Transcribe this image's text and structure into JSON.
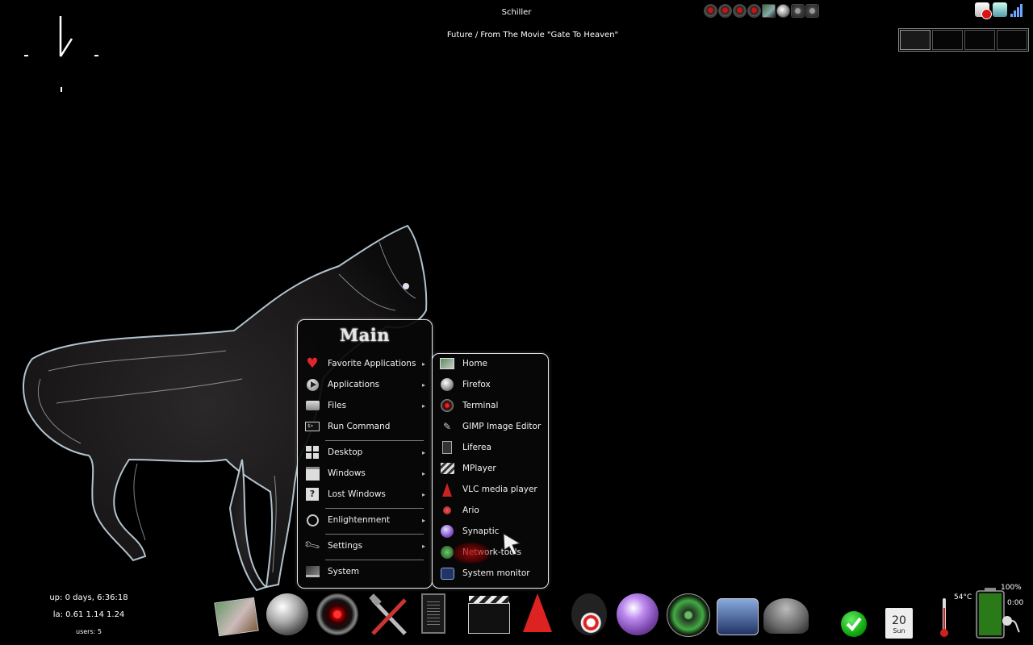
{
  "now_playing": {
    "artist": "Schiller",
    "track": "Future / From The Movie \"Gate To Heaven\""
  },
  "tray": {
    "icons": [
      "hal-icon",
      "hal-icon",
      "hal-icon",
      "hal-icon",
      "home-folder-icon",
      "globe-icon",
      "gnome-face-icon",
      "gnome-face-icon"
    ]
  },
  "notification_area": {
    "icons": [
      "blocked-notification-icon",
      "network-manager-icon",
      "signal-strength-icon"
    ]
  },
  "pager": {
    "desktops": 4,
    "active": 0
  },
  "main_menu": {
    "title": "Main",
    "items": [
      {
        "label": "Favorite Applications",
        "icon": "heart-icon",
        "submenu": true
      },
      {
        "label": "Applications",
        "icon": "play-icon",
        "submenu": true
      },
      {
        "label": "Files",
        "icon": "folder-icon",
        "submenu": true
      },
      {
        "label": "Run Command",
        "icon": "terminal-icon",
        "submenu": false
      },
      {
        "label": "Desktop",
        "icon": "grid-icon",
        "submenu": true
      },
      {
        "label": "Windows",
        "icon": "window-icon",
        "submenu": true
      },
      {
        "label": "Lost Windows",
        "icon": "question-icon",
        "submenu": true
      },
      {
        "label": "Enlightenment",
        "icon": "enlightenment-icon",
        "submenu": true
      },
      {
        "label": "Settings",
        "icon": "wrench-icon",
        "submenu": true
      },
      {
        "label": "System",
        "icon": "laptop-icon",
        "submenu": false
      }
    ],
    "submenu_arrow": "▸"
  },
  "favorites_menu": {
    "items": [
      {
        "label": "Home",
        "icon": "home-folder-icon"
      },
      {
        "label": "Firefox",
        "icon": "globe-icon"
      },
      {
        "label": "Terminal",
        "icon": "hal-eye-icon"
      },
      {
        "label": "GIMP Image Editor",
        "icon": "gimp-icon"
      },
      {
        "label": "Liferea",
        "icon": "book-icon"
      },
      {
        "label": "MPlayer",
        "icon": "clapperboard-icon"
      },
      {
        "label": "VLC media player",
        "icon": "traffic-cone-icon"
      },
      {
        "label": "Ario",
        "icon": "ario-icon"
      },
      {
        "label": "Synaptic",
        "icon": "synaptic-icon"
      },
      {
        "label": "Network-tools",
        "icon": "radar-icon"
      },
      {
        "label": "System monitor",
        "icon": "system-monitor-icon"
      }
    ]
  },
  "system_stats": {
    "uptime": "up: 0 days, 6:36:18",
    "load": "la: 0.61 1.14 1.24",
    "users": "users: 5"
  },
  "dock": {
    "items": [
      "home-folder-icon",
      "globe-icon",
      "hal-eye-icon",
      "tools-icon",
      "book-icon",
      "clapperboard-icon",
      "traffic-cone-icon",
      "headphones-icon",
      "synaptic-icon",
      "radar-icon",
      "system-monitor-icon",
      "umbrella-icon"
    ]
  },
  "calendar": {
    "day": "20",
    "weekday": "Sun"
  },
  "temperature": "54°C",
  "battery": {
    "percent": "100%",
    "time": "0:00",
    "level": 1.0
  },
  "colors": {
    "background": "#000000",
    "menu_border": "#e8e8e8",
    "heart": "#e0262b",
    "battery_fill": "#2a7a1a"
  }
}
